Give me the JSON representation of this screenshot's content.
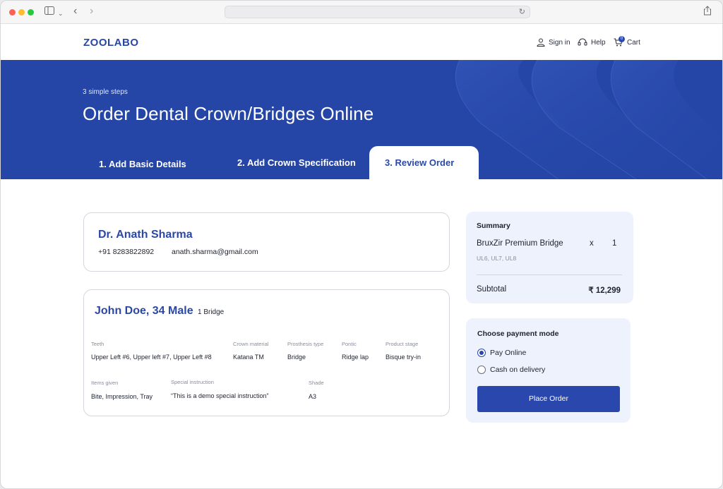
{
  "browser": {
    "back_icon": "chevron-left-icon",
    "forward_icon": "chevron-right-icon",
    "sidebar_icon": "sidebar-icon",
    "share_icon": "share-icon",
    "reload_icon": "reload-icon"
  },
  "header": {
    "logo": "ZOOLABO",
    "sign_in": "Sign in",
    "help": "Help",
    "cart": "Cart",
    "cart_count": "0"
  },
  "hero": {
    "subtitle": "3 simple steps",
    "title": "Order Dental Crown/Bridges Online",
    "tabs": [
      {
        "label": "1. Add Basic Details"
      },
      {
        "label": "2. Add Crown Specification"
      },
      {
        "label": "3. Review Order"
      }
    ]
  },
  "doctor": {
    "name": "Dr. Anath Sharma",
    "phone": "+91 8283822892",
    "email": "anath.sharma@gmail.com"
  },
  "patient": {
    "name": "John Doe, 34 Male",
    "tag": "1 Bridge",
    "fields": {
      "teeth": {
        "label": "Teeth",
        "value": "Upper Left #6, Upper left #7, Upper Left #8"
      },
      "crown_material": {
        "label": "Crown material",
        "value": "Katana TM"
      },
      "prosthesis_type": {
        "label": "Prosthesis type",
        "value": "Bridge"
      },
      "pontic": {
        "label": "Pontic",
        "value": "Ridge lap"
      },
      "product_stage": {
        "label": "Product stage",
        "value": "Bisque try-in"
      },
      "items_given": {
        "label": "Items given",
        "value": "Bite, Impression, Tray"
      },
      "special_instruction": {
        "label": "Special instruction",
        "value": "“This is a demo special instruction”"
      },
      "shade": {
        "label": "Shade",
        "value": "A3"
      }
    }
  },
  "summary": {
    "title": "Summary",
    "item": "BruxZir Premium Bridge",
    "x": "x",
    "qty": "1",
    "teeth": "UL6, UL7, UL8",
    "subtotal_label": "Subtotal",
    "subtotal_value": "₹ 12,299"
  },
  "payment": {
    "title": "Choose payment mode",
    "options": [
      {
        "label": "Pay Online",
        "selected": true
      },
      {
        "label": "Cash on delivery",
        "selected": false
      }
    ],
    "button": "Place Order"
  },
  "colors": {
    "brand": "#2546a7",
    "accent": "#2a47ad",
    "panel": "#eef2fc"
  }
}
